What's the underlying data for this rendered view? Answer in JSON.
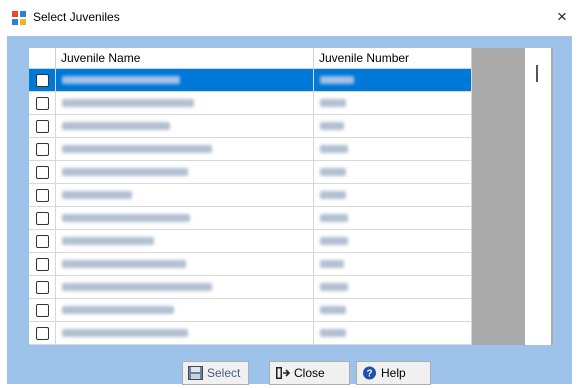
{
  "window": {
    "title": "Select Juveniles",
    "close_glyph": "×",
    "title_icon": "app-grid-icon"
  },
  "grid": {
    "columns": [
      "",
      "Juvenile Name",
      "Juvenile Number"
    ],
    "rows": [
      {
        "selected": true,
        "checked": false
      },
      {
        "selected": false,
        "checked": false
      },
      {
        "selected": false,
        "checked": false
      },
      {
        "selected": false,
        "checked": false
      },
      {
        "selected": false,
        "checked": false
      },
      {
        "selected": false,
        "checked": false
      },
      {
        "selected": false,
        "checked": false
      },
      {
        "selected": false,
        "checked": false
      },
      {
        "selected": false,
        "checked": false
      },
      {
        "selected": false,
        "checked": false
      },
      {
        "selected": false,
        "checked": false
      },
      {
        "selected": false,
        "checked": false
      }
    ]
  },
  "buttons": {
    "select_label": "Select",
    "close_label": "Close",
    "help_label": "Help"
  },
  "colors": {
    "client_bg": "#9ec3ea",
    "selection": "#0078d7"
  }
}
